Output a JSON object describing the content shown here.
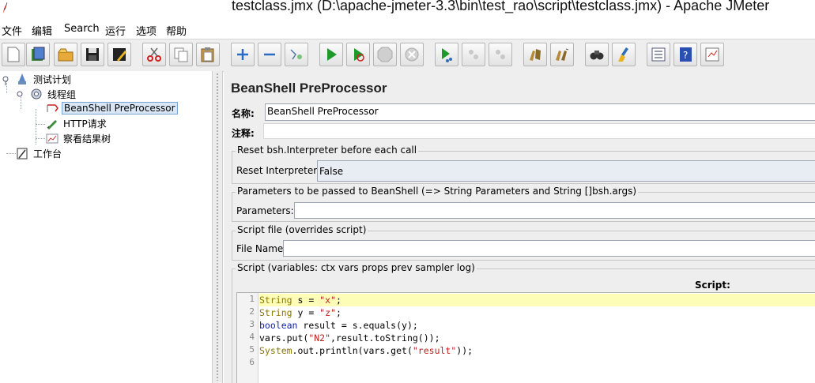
{
  "window": {
    "title": "testclass.jmx (D:\\apache-jmeter-3.3\\bin\\test_rao\\script\\testclass.jmx) - Apache JMeter"
  },
  "menu": [
    "文件",
    "编辑",
    "Search",
    "运行",
    "选项",
    "帮助"
  ],
  "toolbar": {
    "buttons": [
      "new-icon",
      "templates-icon",
      "open-icon",
      "save-icon",
      "save-as-icon",
      "cut-icon",
      "copy-icon",
      "paste-icon",
      "expand-icon",
      "collapse-icon",
      "toggle-icon",
      "start-icon",
      "start-no-pause-icon",
      "stop-icon",
      "shutdown-icon",
      "remote-start-icon",
      "remote-stop-icon",
      "remote-shutdown-icon",
      "clear-icon",
      "clear-all-icon",
      "search-icon",
      "reset-search-icon",
      "function-helper-icon",
      "help-icon",
      "log-viewer-icon"
    ]
  },
  "tree": {
    "test_plan": "测试计划",
    "thread_group": "线程组",
    "preprocessor": "BeanShell PreProcessor",
    "http_request": "HTTP请求",
    "result_tree": "察看结果树",
    "workbench": "工作台"
  },
  "panel": {
    "heading": "BeanShell PreProcessor",
    "name_label": "名称:",
    "name_value": "BeanShell PreProcessor",
    "comment_label": "注释:",
    "comment_value": "",
    "reset_group": "Reset bsh.Interpreter before each call",
    "reset_label": "Reset Interpreter:",
    "reset_value": "False",
    "params_group": "Parameters to be passed to BeanShell (=> String Parameters and String []bsh.args)",
    "params_label": "Parameters:",
    "params_value": "",
    "file_group": "Script file (overrides script)",
    "file_label": "File Name:",
    "file_value": "",
    "script_group": "Script (variables: ctx vars props prev sampler log)",
    "script_label": "Script:"
  },
  "script_lines": [
    "String s = \"x\";",
    "String y = \"z\";",
    "boolean result = s.equals(y);",
    "vars.put(\"N2\",result.toString());",
    "System.out.println(vars.get(\"result\"));",
    ""
  ],
  "line_numbers": [
    "1",
    "2",
    "3",
    "4",
    "5",
    "6"
  ]
}
